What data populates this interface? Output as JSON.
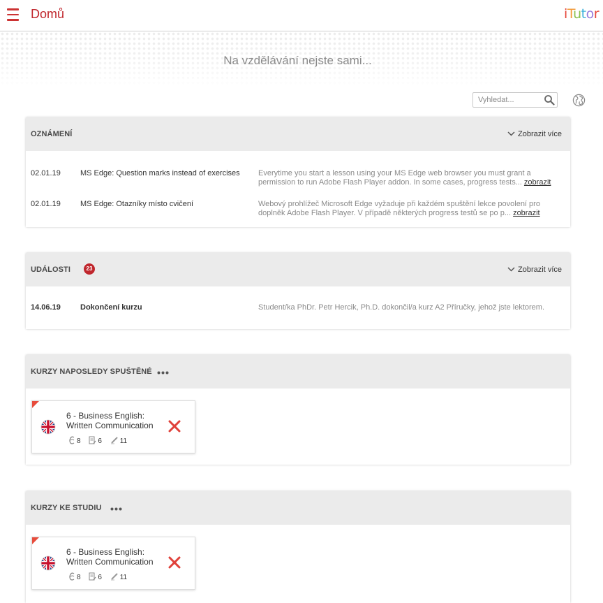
{
  "header": {
    "title": "Domů",
    "logo": "iTutor"
  },
  "hero": {
    "tagline": "Na vzdělávání nejste sami..."
  },
  "search": {
    "placeholder": "Vyhledat..."
  },
  "colors": {
    "accent": "#c0272d",
    "panel_header": "#ebebeb"
  },
  "icons": [
    "menu-icon",
    "search-icon",
    "globe-icon",
    "chevron-down-icon",
    "more-dots-icon",
    "uk-flag-icon",
    "lesson-icon",
    "test-icon",
    "pen-icon",
    "remove-icon"
  ],
  "announcements": {
    "title": "Oznámení",
    "show_more": "Zobrazit více",
    "items": [
      {
        "date": "02.01.19",
        "title": "MS Edge: Question marks instead of exercises",
        "desc": "Everytime you start a lesson using your MS Edge web browser you must grant a permission to run Adobe Flash Player addon. In some cases, progress tests...",
        "link": "zobrazit"
      },
      {
        "date": "02.01.19",
        "title": "MS Edge: Otazníky místo cvičení",
        "desc": "Webový prohlížeč Microsoft Edge vyžaduje při každém spuštění lekce povolení pro doplněk Adobe Flash Player. V případě některých progress testů se po p...",
        "link": "zobrazit"
      }
    ]
  },
  "events": {
    "title": "Události",
    "count": "23",
    "show_more": "Zobrazit více",
    "items": [
      {
        "date": "14.06.19",
        "title": "Dokončení kurzu",
        "desc": "Student/ka PhDr. Petr Hercik, Ph.D. dokončil/a kurz A2 Příručky, jehož jste lektorem."
      }
    ]
  },
  "recent_courses": {
    "title": "Kurzy naposledy spuštěné",
    "courses": [
      {
        "name": "6 - Business English: Written Communication",
        "lessons": "8",
        "tests": "6",
        "tasks": "11"
      }
    ]
  },
  "study_courses": {
    "title": "Kurzy ke studiu",
    "courses": [
      {
        "name": "6 - Business English: Written Communication",
        "lessons": "8",
        "tests": "6",
        "tasks": "11"
      }
    ]
  }
}
